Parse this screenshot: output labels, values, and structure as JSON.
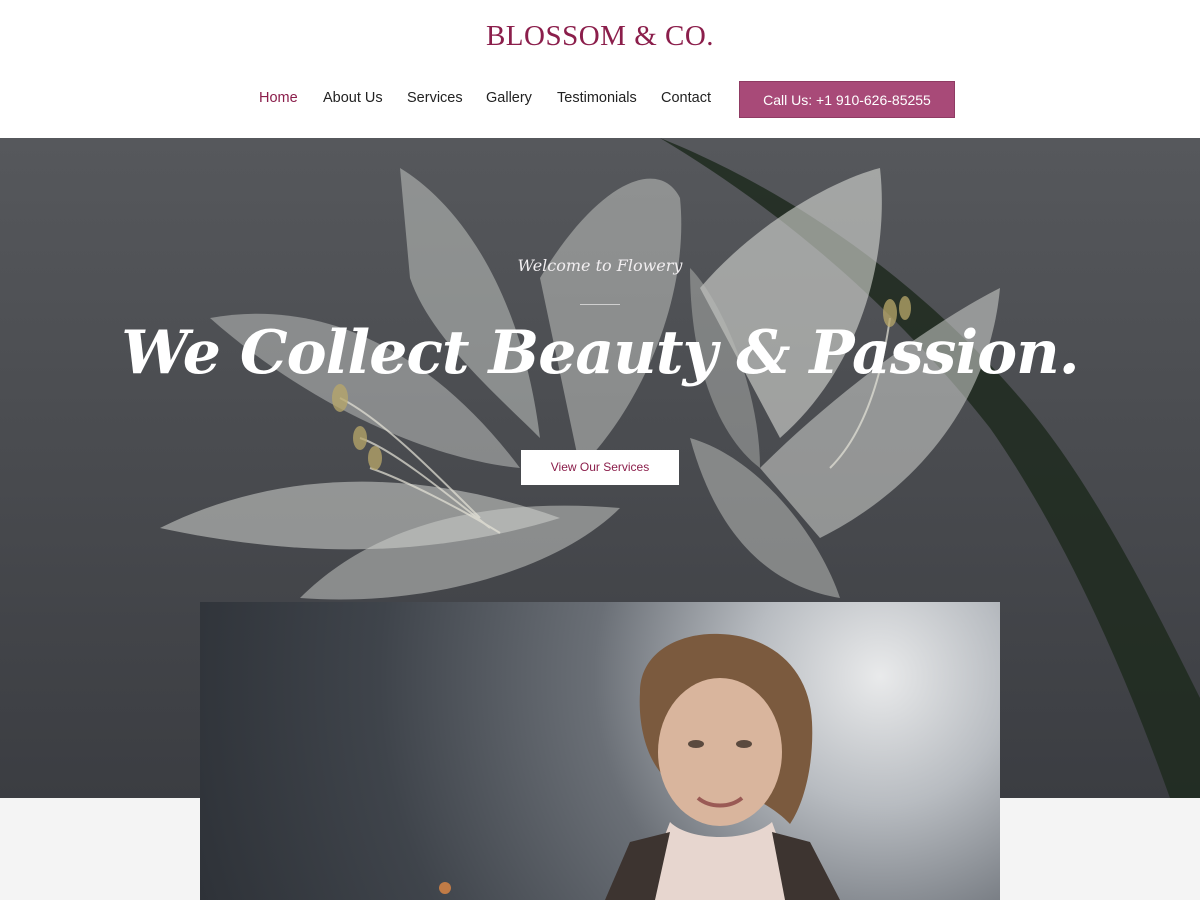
{
  "brand": {
    "logo": "BLOSSOM & CO."
  },
  "nav": {
    "items": [
      {
        "label": "Home",
        "active": true
      },
      {
        "label": "About Us",
        "active": false
      },
      {
        "label": "Services",
        "active": false
      },
      {
        "label": "Gallery",
        "active": false
      },
      {
        "label": "Testimonials",
        "active": false
      },
      {
        "label": "Contact",
        "active": false
      }
    ],
    "cta_label": "Call Us: +1 910-626-85255"
  },
  "hero": {
    "subtitle": "Welcome to Flowery",
    "title": "We Collect Beauty & Passion.",
    "button_label": "View Our Services"
  },
  "colors": {
    "brand": "#8b1e4b",
    "cta": "#a84a78",
    "hero_bg": "#4a4c50"
  }
}
